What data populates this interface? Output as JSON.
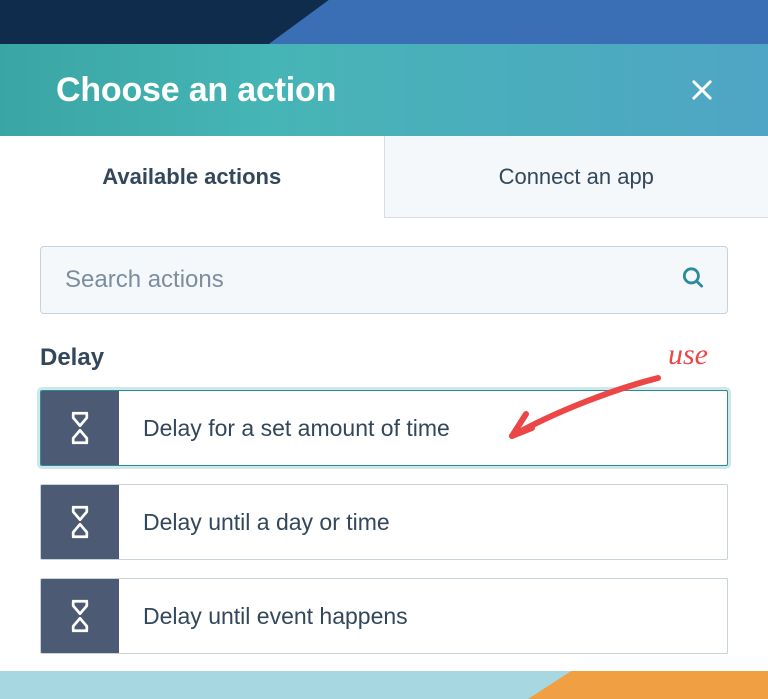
{
  "header": {
    "title": "Choose an action",
    "close_icon": "close"
  },
  "tabs": {
    "available": "Available actions",
    "connect": "Connect an app"
  },
  "search": {
    "placeholder": "Search actions",
    "value": ""
  },
  "section": {
    "delay_title": "Delay",
    "items": [
      {
        "label": "Delay for a set amount of time",
        "icon": "hourglass",
        "selected": true
      },
      {
        "label": "Delay until a day or time",
        "icon": "hourglass",
        "selected": false
      },
      {
        "label": "Delay until event happens",
        "icon": "hourglass",
        "selected": false
      }
    ]
  },
  "annotation": {
    "text": "use"
  }
}
